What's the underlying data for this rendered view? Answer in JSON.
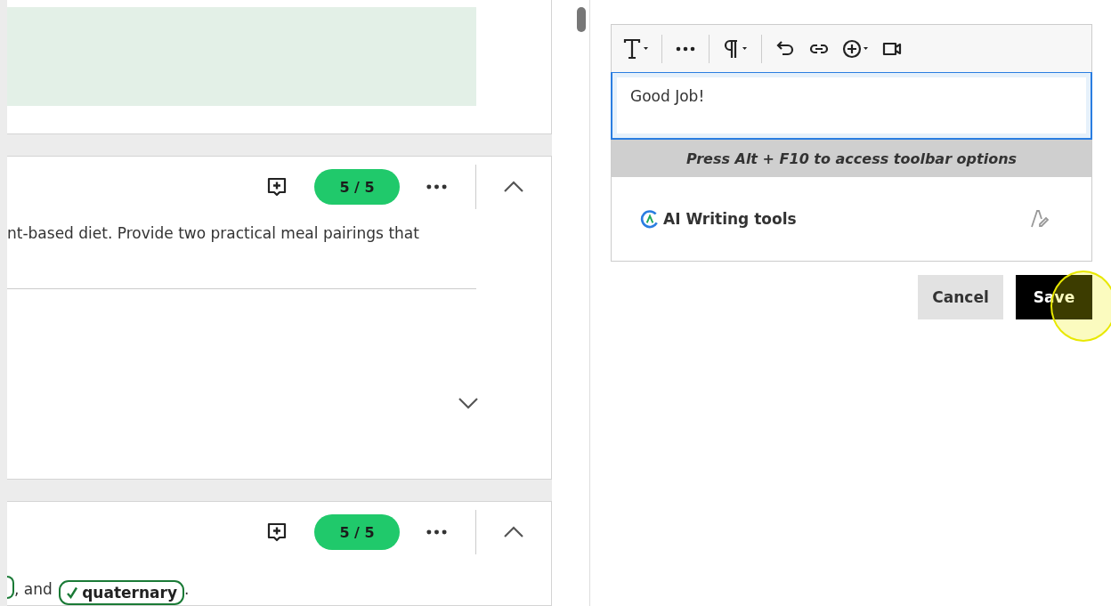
{
  "cards": [
    {
      "kind": "image"
    },
    {
      "kind": "question",
      "score": "5 / 5",
      "text": "nt-based diet. Provide two practical meal pairings that",
      "expanded": true,
      "answer_expanded": false
    },
    {
      "kind": "chips",
      "score": "5 / 5",
      "between": ", and ",
      "chip": "quaternary",
      "after": ".",
      "expanded": true
    }
  ],
  "editor": {
    "value": "Good Job!",
    "hint": "Press Alt + F10 to access toolbar options",
    "ai_tools": "AI Writing tools"
  },
  "buttons": {
    "cancel": "Cancel",
    "save": "Save"
  }
}
